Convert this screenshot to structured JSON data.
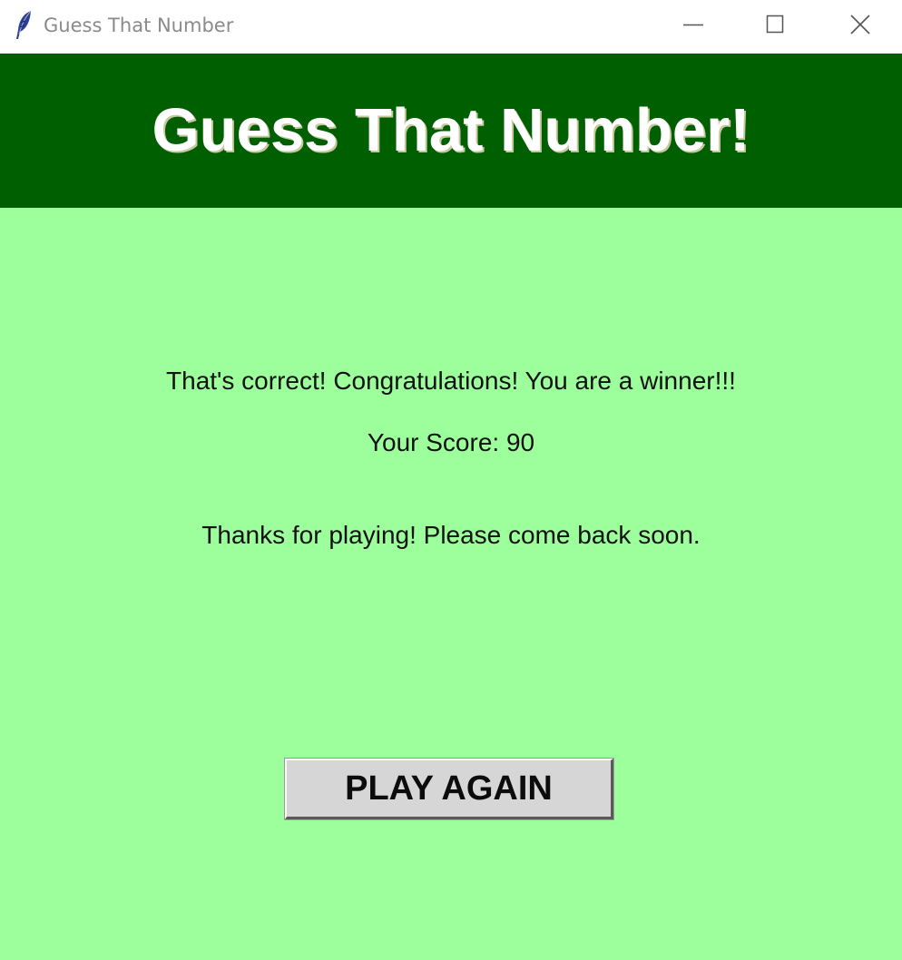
{
  "window": {
    "title": "Guess That Number",
    "controls": {
      "minimize_icon": "minimize-icon",
      "maximize_icon": "maximize-icon",
      "close_icon": "close-icon"
    }
  },
  "header": {
    "title": "Guess That Number!",
    "color": "#005f00"
  },
  "content": {
    "background": "#9cff9c",
    "winner_message": "That's correct! Congratulations! You are a winner!!!",
    "score_text": "Your Score: 90",
    "thanks_message": "Thanks for playing! Please come back soon."
  },
  "play_again_button": {
    "label": "PLAY AGAIN"
  }
}
